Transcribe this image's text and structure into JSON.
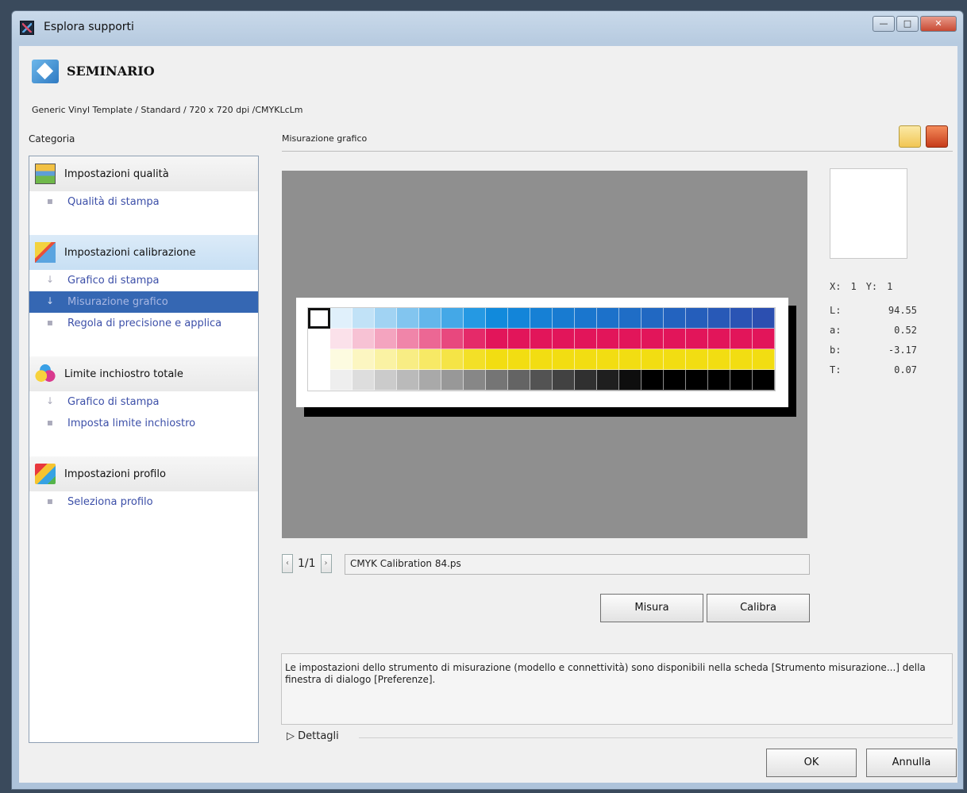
{
  "window": {
    "title": "Esplora supporti",
    "controls": {
      "minimize": "—",
      "maximize": "□",
      "close": "✕"
    }
  },
  "header": {
    "title": "SEMINARIO",
    "subtitle": "Generic Vinyl Template / Standard / 720 x 720 dpi /CMYKLcLm"
  },
  "sidebar": {
    "label": "Categoria",
    "groups": [
      {
        "title": "Impostazioni qualità",
        "icon": "quality-settings-icon",
        "items": [
          "Qualità di stampa"
        ]
      },
      {
        "title": "Impostazioni calibrazione",
        "icon": "calibration-settings-icon",
        "items": [
          "Grafico di stampa",
          "Misurazione grafico",
          "Regola di precisione e applica"
        ],
        "selected": 1
      },
      {
        "title": "Limite inchiostro totale",
        "icon": "ink-limit-icon",
        "items": [
          "Grafico di stampa",
          "Imposta limite inchiostro"
        ]
      },
      {
        "title": "Impostazioni profilo",
        "icon": "profile-settings-icon",
        "items": [
          "Seleziona profilo"
        ]
      }
    ],
    "bullets": {
      "step": "↓",
      "dot": "▪"
    }
  },
  "main": {
    "section_label": "Misurazione grafico",
    "chart": {
      "rows": [
        "cyan",
        "magenta",
        "yellow",
        "black"
      ],
      "columns": 21,
      "row_colors": {
        "cyan": "#0f8fe0",
        "magenta": "#e2155a",
        "yellow": "#f2dd12",
        "black": "#000000"
      },
      "dark_end": {
        "cyan": "#2c4fb0"
      },
      "selected_cell": [
        0,
        0
      ]
    },
    "readout": {
      "x_label": "X:",
      "x": "1",
      "y_label": "Y:",
      "y": "1",
      "rows": [
        {
          "label": "L:",
          "value": "94.55"
        },
        {
          "label": "a:",
          "value": "0.52"
        },
        {
          "label": "b:",
          "value": "-3.17"
        },
        {
          "label": "T:",
          "value": "0.07"
        }
      ]
    },
    "pager": {
      "prev": "‹",
      "next": "›",
      "page": "1/1",
      "file": "CMYK Calibration 84.ps"
    },
    "buttons": {
      "measure": "Misura",
      "calibrate": "Calibra"
    },
    "info": "Le impostazioni dello strumento di misurazione (modello e connettività) sono disponibili nella scheda [Strumento misurazione...] della finestra di dialogo [Preferenze].",
    "details": "▷ Dettagli"
  },
  "footer": {
    "ok": "OK",
    "cancel": "Annulla"
  }
}
